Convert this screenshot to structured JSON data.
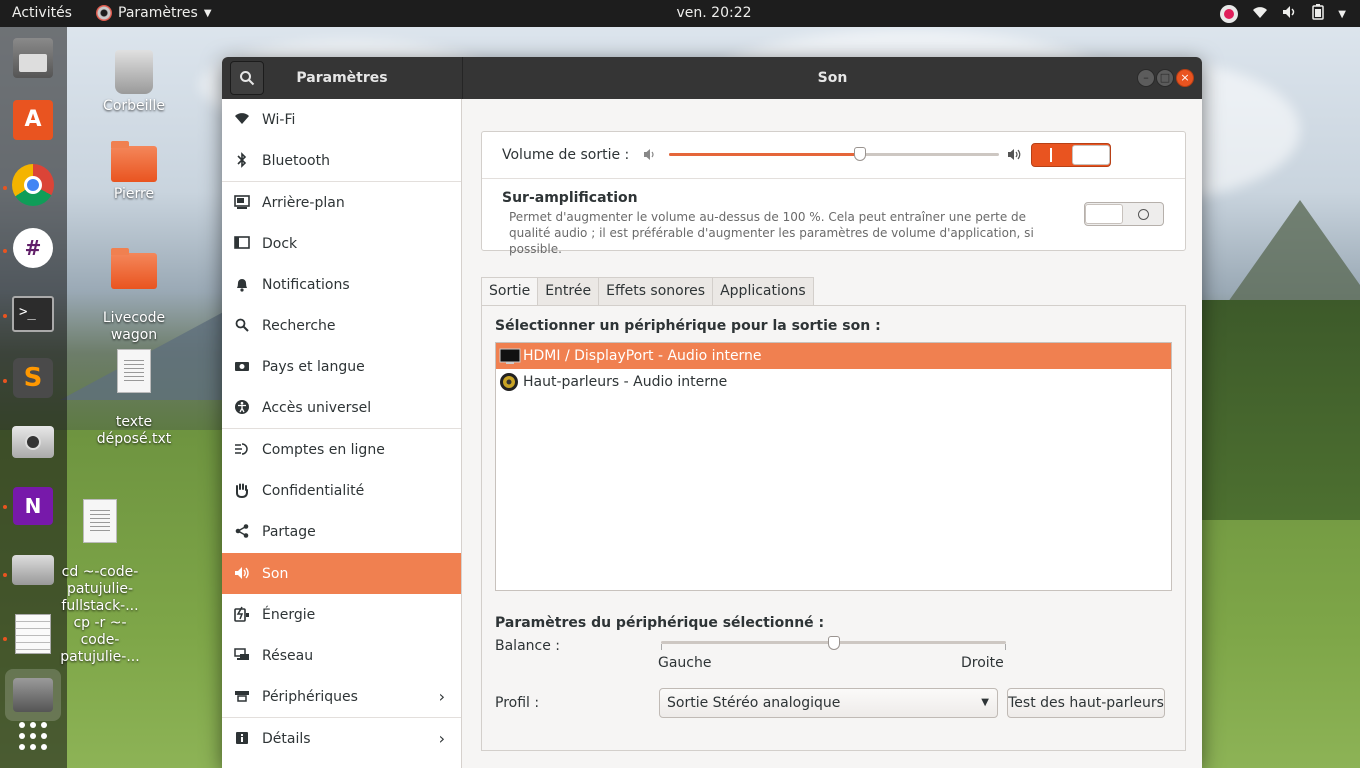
{
  "topbar": {
    "activities": "Activités",
    "app_name": "Paramètres",
    "clock": "ven. 20:22"
  },
  "dock": {
    "items": [
      "files-icon",
      "software-icon",
      "chrome-icon",
      "slack-icon",
      "terminal-icon",
      "sublime-icon",
      "camera-icon",
      "onenote-icon",
      "scanner-icon",
      "editor-icon",
      "settings-icon",
      "apps-grid-icon"
    ]
  },
  "desktop": {
    "icons": [
      {
        "label": "Corbeille"
      },
      {
        "label": "Pierre"
      },
      {
        "label": "Livecode\nwagon"
      },
      {
        "label": "texte\ndéposé.txt"
      },
      {
        "label": "cd ~-code-\npatujulie-\nfullstack-...\ncp -r ~-\ncode-\npatujulie-..."
      }
    ]
  },
  "window": {
    "left_title": "Paramètres",
    "main_title": "Son"
  },
  "sidebar": {
    "items": [
      {
        "label": "Wi-Fi"
      },
      {
        "label": "Bluetooth"
      },
      {
        "label": "Arrière-plan"
      },
      {
        "label": "Dock"
      },
      {
        "label": "Notifications"
      },
      {
        "label": "Recherche"
      },
      {
        "label": "Pays et langue"
      },
      {
        "label": "Accès universel"
      },
      {
        "label": "Comptes en ligne"
      },
      {
        "label": "Confidentialité"
      },
      {
        "label": "Partage"
      },
      {
        "label": "Son"
      },
      {
        "label": "Énergie"
      },
      {
        "label": "Réseau"
      },
      {
        "label": "Périphériques"
      },
      {
        "label": "Détails"
      }
    ],
    "active": "Son"
  },
  "sound": {
    "volume_label": "Volume de sortie :",
    "volume_percent": 58,
    "volume_toggle": "on",
    "amp_title": "Sur-amplification",
    "amp_desc": "Permet d'augmenter le volume au-dessus de 100 %. Cela peut entraîner une perte de qualité audio ; il est préférable d'augmenter les paramètres de volume d'application, si possible.",
    "amp_toggle": "off",
    "tabs": [
      "Sortie",
      "Entrée",
      "Effets sonores",
      "Applications"
    ],
    "active_tab": "Sortie",
    "select_device_label": "Sélectionner un périphérique pour la sortie son :",
    "devices": [
      {
        "label": "HDMI / DisplayPort - Audio interne",
        "selected": true
      },
      {
        "label": "Haut-parleurs - Audio interne",
        "selected": false
      }
    ],
    "device_settings_label": "Paramètres du périphérique sélectionné :",
    "balance_label": "Balance :",
    "balance_value": 0.5,
    "balance_left": "Gauche",
    "balance_right": "Droite",
    "profile_label": "Profil :",
    "profile_value": "Sortie Stéréo analogique",
    "test_button": "Test des haut-parleurs"
  },
  "colors": {
    "accent": "#e95420",
    "selection": "#f08050"
  }
}
